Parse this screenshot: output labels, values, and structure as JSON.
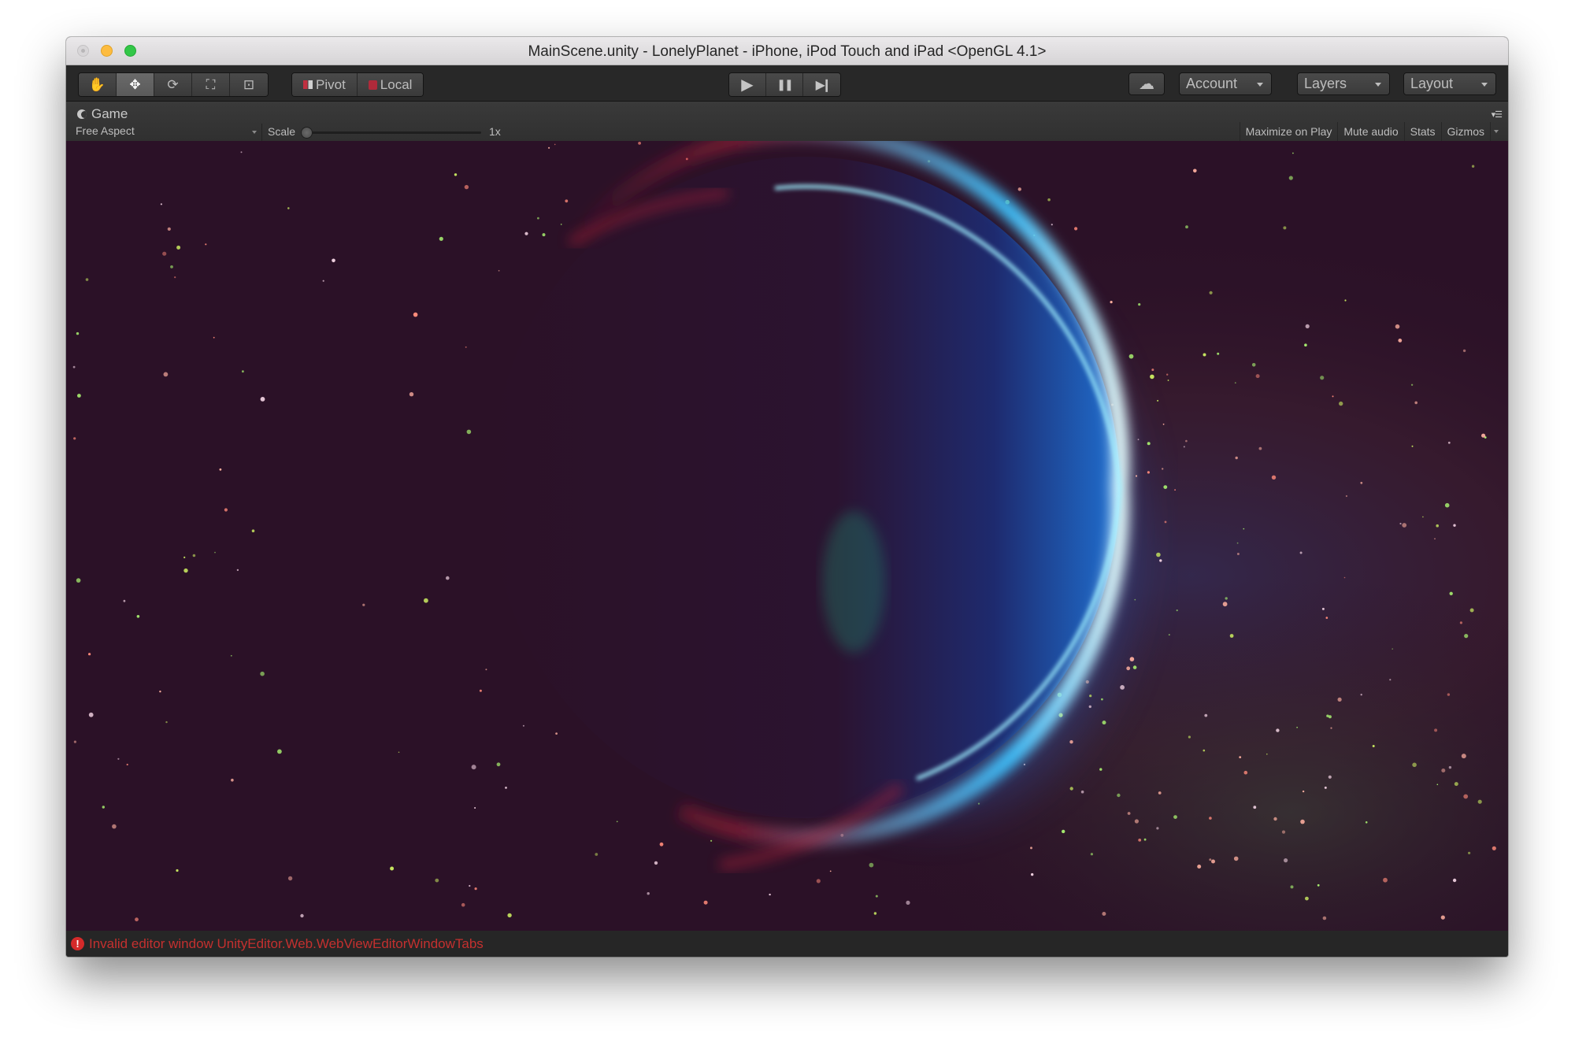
{
  "window": {
    "title": "MainScene.unity - LonelyPlanet - iPhone, iPod Touch and iPad <OpenGL 4.1>"
  },
  "toolbar": {
    "tools": [
      {
        "name": "hand-tool",
        "icon": "hand-icon",
        "glyph": "✋",
        "active": false
      },
      {
        "name": "move-tool",
        "icon": "move-arrows-icon",
        "glyph": "✥",
        "active": true
      },
      {
        "name": "rotate-tool",
        "icon": "rotate-icon",
        "glyph": "⟳",
        "active": false
      },
      {
        "name": "scale-tool",
        "icon": "scale-icon",
        "glyph": "⛶",
        "active": false
      },
      {
        "name": "rect-tool",
        "icon": "rect-transform-icon",
        "glyph": "⊡",
        "active": false
      }
    ],
    "pivot_label": "Pivot",
    "local_label": "Local",
    "play_glyph": "▶",
    "pause_glyph": "❚❚",
    "step_glyph": "▶❙",
    "cloud_glyph": "☁",
    "account_label": "Account",
    "layers_label": "Layers",
    "layout_label": "Layout"
  },
  "panel": {
    "tab_label": "Game",
    "aspect_value": "Free Aspect",
    "scale_label": "Scale",
    "scale_value": "1x",
    "scale_fraction": 0.0,
    "buttons": [
      "Maximize on Play",
      "Mute audio",
      "Stats",
      "Gizmos"
    ],
    "menu_glyph": "▾☰"
  },
  "scene": {
    "background_color": "#2b1127",
    "planet_rim_color": "#3ec3ff",
    "atmosphere_red": "#b0203a"
  },
  "status": {
    "error_glyph": "!",
    "message": "Invalid editor window UnityEditor.Web.WebViewEditorWindowTabs",
    "color": "#c4302f"
  }
}
